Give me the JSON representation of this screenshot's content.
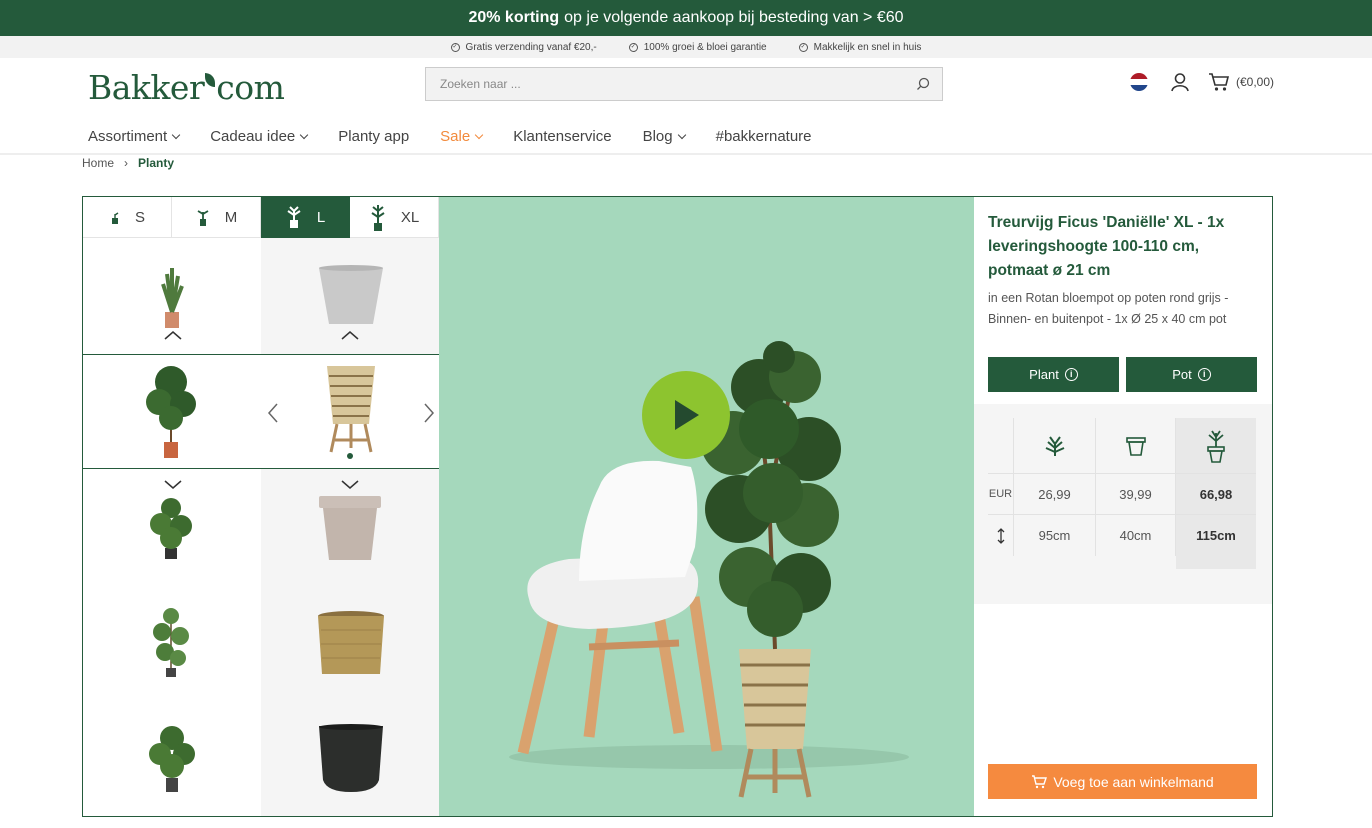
{
  "promo": {
    "bold": "20% korting",
    "rest": "op je volgende aankoop bij besteding van > €60"
  },
  "usps": [
    "Gratis verzending vanaf €20,-",
    "100% groei & bloei garantie",
    "Makkelijk en snel in huis"
  ],
  "logo": {
    "left": "Bakker",
    "right": "com"
  },
  "search": {
    "placeholder": "Zoeken naar ..."
  },
  "header": {
    "cart_total": "(€0,00)"
  },
  "nav": [
    {
      "label": "Assortiment",
      "dropdown": true
    },
    {
      "label": "Cadeau idee",
      "dropdown": true
    },
    {
      "label": "Planty app",
      "dropdown": false
    },
    {
      "label": "Sale",
      "dropdown": true
    },
    {
      "label": "Klantenservice",
      "dropdown": false
    },
    {
      "label": "Blog",
      "dropdown": true
    },
    {
      "label": "#bakkernature",
      "dropdown": false
    }
  ],
  "breadcrumb": {
    "home": "Home",
    "current": "Planty"
  },
  "size_tabs": [
    {
      "label": "S",
      "active": false
    },
    {
      "label": "M",
      "active": false
    },
    {
      "label": "L",
      "active": true
    },
    {
      "label": "XL",
      "active": false
    }
  ],
  "product": {
    "title": "Treurvijg Ficus 'Daniëlle' XL - 1x leveringshoogte 100-110 cm, potmaat ø 21 cm",
    "subtitle": "in een Rotan bloempot op poten rond grijs - Binnen- en buitenpot - 1x Ø 25 x 40 cm pot",
    "plant_button": "Plant",
    "pot_button": "Pot",
    "price_label": "EUR",
    "prices": [
      "26,99",
      "39,99",
      "66,98"
    ],
    "heights": [
      "95cm",
      "40cm",
      "115cm"
    ],
    "add_to_cart": "Voeg toe aan winkelmand"
  },
  "colors": {
    "brand_green": "#245a3b",
    "accent_orange": "#f58a3f",
    "play_green": "#8dc42f",
    "hero_bg": "#a5d8bc"
  }
}
